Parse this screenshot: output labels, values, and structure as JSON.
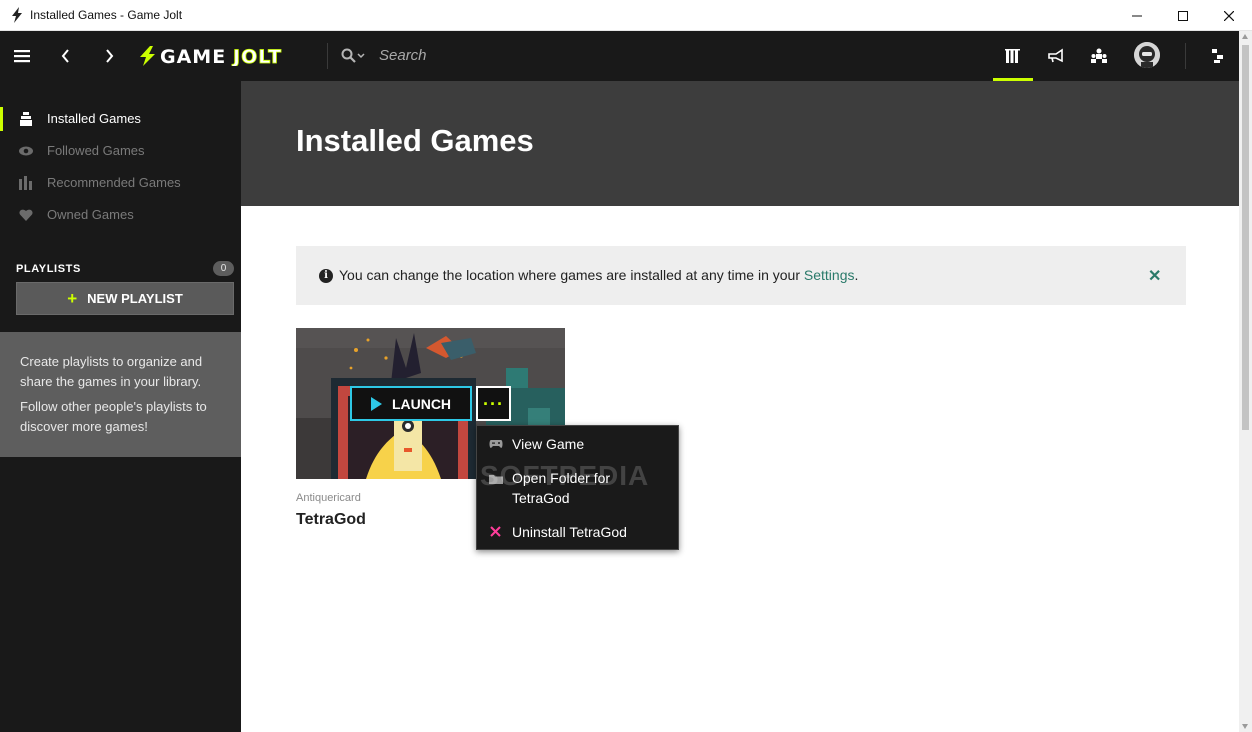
{
  "window": {
    "title": "Installed Games - Game Jolt"
  },
  "header": {
    "search_placeholder": "Search",
    "logo_text": "GAME JOLT",
    "accent_color": "#ccff00"
  },
  "sidebar": {
    "items": [
      {
        "label": "Installed Games",
        "icon": "installed-games-icon",
        "active": true
      },
      {
        "label": "Followed Games",
        "icon": "eye-icon",
        "active": false
      },
      {
        "label": "Recommended Games",
        "icon": "chart-bars-icon",
        "active": false
      },
      {
        "label": "Owned Games",
        "icon": "heart-icon",
        "active": false
      }
    ],
    "playlists_heading": "PLAYLISTS",
    "playlists_count": "0",
    "new_playlist_label": "NEW PLAYLIST",
    "info_lines": [
      "Create playlists to organize and share the games in your library.",
      "Follow other people's playlists to discover more games!"
    ]
  },
  "main": {
    "page_title": "Installed Games",
    "alert": {
      "text": "You can change the location where games are installed at any time in your",
      "link": "Settings",
      "suffix": "."
    },
    "games": [
      {
        "developer": "Antiquericard",
        "title": "TetraGod"
      }
    ],
    "launch_label": "LAUNCH",
    "context_menu": [
      {
        "label": "View Game",
        "icon": "gamepad-icon"
      },
      {
        "label": "Open Folder for TetraGod",
        "icon": "folder-icon"
      },
      {
        "label": "Uninstall TetraGod",
        "icon": "close-icon"
      }
    ],
    "watermark": "SOFTPEDIA"
  }
}
